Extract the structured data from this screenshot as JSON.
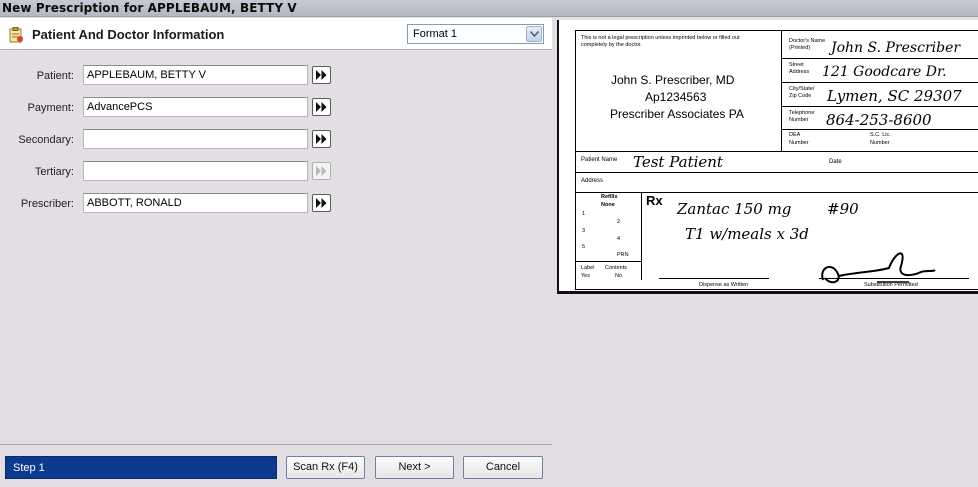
{
  "window": {
    "title": "New Prescription for APPLEBAUM, BETTY V"
  },
  "section": {
    "title": "Patient And Doctor Information",
    "icon": "clipboard-icon",
    "format_value": "Format 1"
  },
  "fields": [
    {
      "label": "Patient:",
      "value": "APPLEBAUM, BETTY V",
      "enabled": true
    },
    {
      "label": "Payment:",
      "value": "AdvancePCS",
      "enabled": true
    },
    {
      "label": "Secondary:",
      "value": "",
      "enabled": true
    },
    {
      "label": "Tertiary:",
      "value": "",
      "enabled": false
    },
    {
      "label": "Prescriber:",
      "value": "ABBOTT, RONALD",
      "enabled": true
    }
  ],
  "footer": {
    "step": "Step 1",
    "scan": "Scan Rx (F4)",
    "next": "Next >",
    "cancel": "Cancel"
  },
  "rx_image": {
    "disclaimer_1": "This is not a legal prescription unless imprinted below or filled out",
    "disclaimer_2": "completely by the doctor.",
    "doctor_name": "John S. Prescriber, MD",
    "doctor_id": "Ap1234563",
    "practice": "Prescriber Associates PA",
    "doctors_name_label": "Doctor's Name",
    "printed_label": "(Printed)",
    "street_label_1": "Street",
    "street_label_2": "Address",
    "city_label_1": "City/State/",
    "city_label_2": "Zip Code",
    "phone_label_1": "Telephone",
    "phone_label_2": "Number",
    "dea_label_1": "DEA",
    "dea_label_2": "Number",
    "sclic_label_1": "S.C. Lic.",
    "sclic_label_2": "Number",
    "hw_name": "John S. Prescriber",
    "hw_street": "121 Goodcare Dr.",
    "hw_city": "Lymen, SC 29307",
    "hw_phone": "864-253-8600",
    "patient_label": "Patient Name",
    "hw_patient": "Test Patient",
    "date_label": "Date",
    "address_label": "Address",
    "refills_label": "Refills",
    "none_label": "None",
    "refill_nums": [
      "1",
      "2",
      "3",
      "4",
      "5"
    ],
    "prn_label": "PRN",
    "label_label": "Label",
    "contents_label": "Contents",
    "yes_label": "Yes",
    "no_label": "No",
    "rx_label": "Rx",
    "hw_line1": "Zantac 150 mg",
    "hw_qty": "#90",
    "hw_line2": "T1 w/meals x 3d",
    "dispense_label": "Dispense as Written",
    "substitution_label": "Substitution Permitted"
  }
}
